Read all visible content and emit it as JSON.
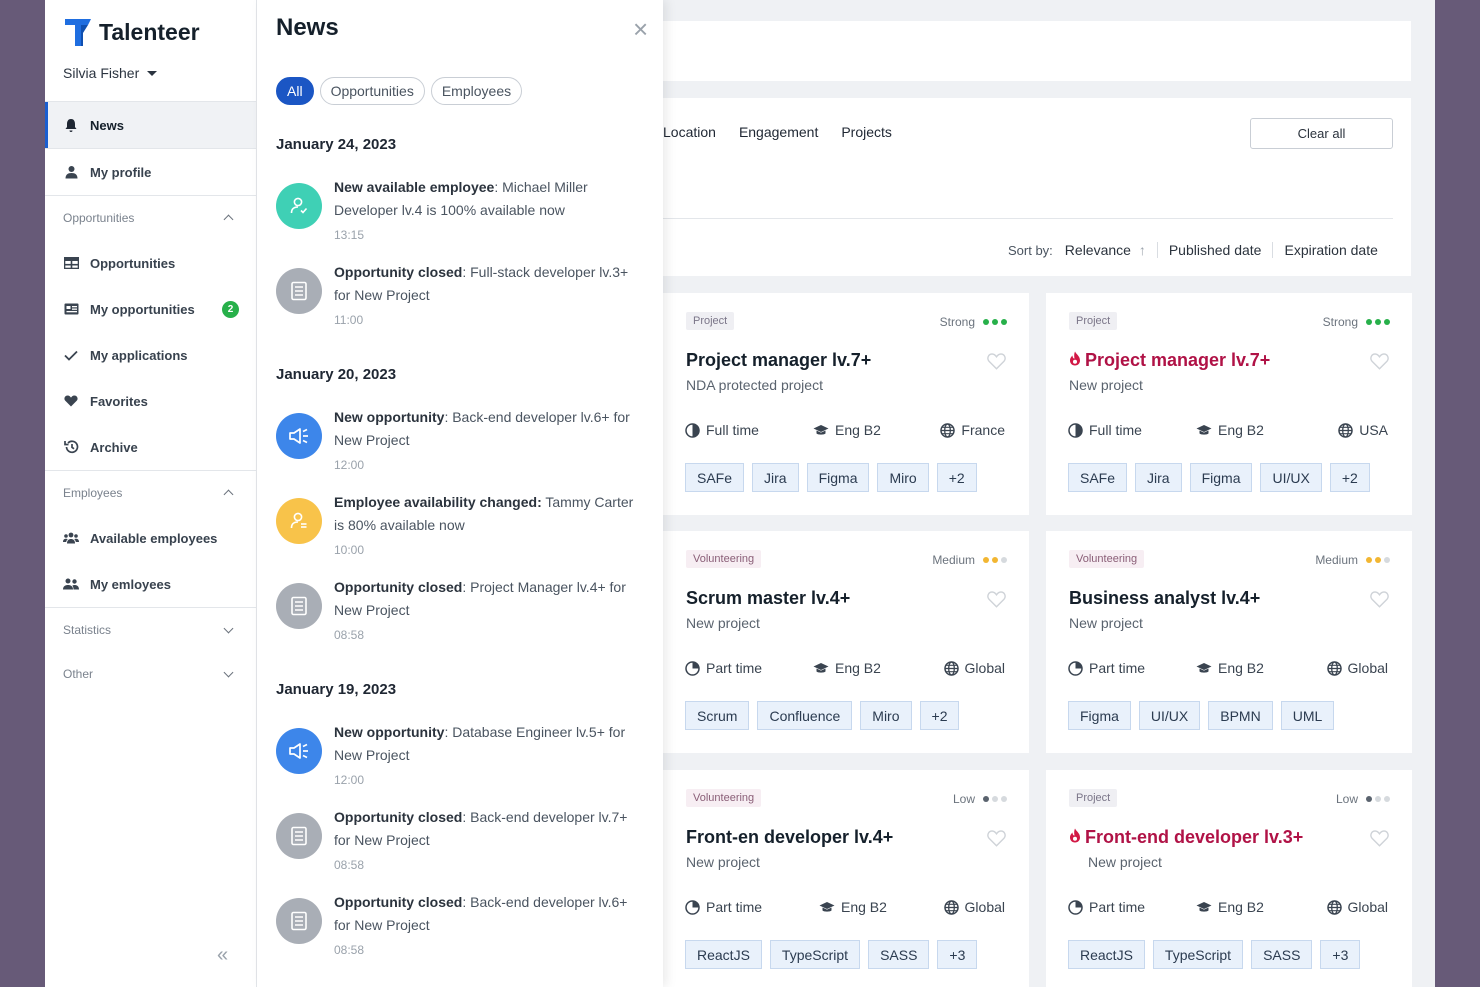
{
  "brand": {
    "name": "Talenteer"
  },
  "user": {
    "name": "Silvia Fisher"
  },
  "sidebar": {
    "items": [
      {
        "label": "News",
        "icon": "bell-icon"
      },
      {
        "label": "My profile",
        "icon": "user-icon"
      }
    ],
    "groups": [
      {
        "label": "Opportunities",
        "items": [
          {
            "label": "Opportunities",
            "icon": "grid-icon"
          },
          {
            "label": "My opportunities",
            "icon": "card-icon",
            "badge": "2"
          },
          {
            "label": "My applications",
            "icon": "check-icon"
          },
          {
            "label": "Favorites",
            "icon": "heart-icon"
          },
          {
            "label": "Archive",
            "icon": "history-icon"
          }
        ]
      },
      {
        "label": "Employees",
        "items": [
          {
            "label": "Available employees",
            "icon": "users-icon"
          },
          {
            "label": "My emloyees",
            "icon": "users-icon"
          }
        ]
      },
      {
        "label": "Statistics"
      },
      {
        "label": "Other"
      }
    ],
    "collapse_label": "«"
  },
  "news": {
    "title": "News",
    "filters": [
      "All",
      "Opportunities",
      "Employees"
    ],
    "groups": [
      {
        "date": "January 24, 2023",
        "items": [
          {
            "type": "employee",
            "bold": "New available employee",
            "text": ": Michael Miller Developer lv.4 is 100% available now",
            "time": "13:15"
          },
          {
            "type": "closed",
            "bold": "Opportunity closed",
            "text": ": Full-stack developer lv.3+ for New Project",
            "time": "11:00"
          }
        ]
      },
      {
        "date": "January 20, 2023",
        "items": [
          {
            "type": "opportunity",
            "bold": "New opportunity",
            "text": ": Back-end developer lv.6+ for New Project",
            "time": "12:00"
          },
          {
            "type": "availability",
            "bold": "Employee availability changed:",
            "text": " Tammy Carter is 80% available now",
            "time": "10:00"
          },
          {
            "type": "closed",
            "bold": "Opportunity closed",
            "text": ": Project Manager lv.4+ for New Project",
            "time": "08:58"
          }
        ]
      },
      {
        "date": "January 19, 2023",
        "items": [
          {
            "type": "opportunity",
            "bold": "New opportunity",
            "text": ": Database Engineer lv.5+ for New Project",
            "time": "12:00"
          },
          {
            "type": "closed",
            "bold": "Opportunity closed",
            "text": ": Back-end developer lv.7+ for New Project",
            "time": "08:58"
          },
          {
            "type": "closed",
            "bold": "Opportunity closed",
            "text": ": Back-end developer lv.6+ for New Project",
            "time": "08:58"
          }
        ]
      }
    ],
    "type_colors": {
      "employee": "#3fd0b5",
      "closed": "#a9aeb6",
      "opportunity": "#3d86ea",
      "availability": "#f8c34a"
    }
  },
  "filters_bar": {
    "tabs": [
      "Location",
      "Engagement",
      "Projects"
    ],
    "clear_label": "Clear all",
    "sort_label": "Sort by:",
    "sort_options": [
      "Relevance",
      "Published date",
      "Expiration date"
    ]
  },
  "jobs": [
    {
      "tag": "Project",
      "match": "Strong",
      "match_level": 3,
      "title": "Project manager lv.7+",
      "hot": false,
      "subtitle": "NDA protected project",
      "schedule": "Full time",
      "language": "Eng B2",
      "location": "France",
      "skills": [
        "SAFe",
        "Jira",
        "Figma",
        "Miro",
        "+2"
      ]
    },
    {
      "tag": "Project",
      "match": "Strong",
      "match_level": 3,
      "title": "Project manager lv.7+",
      "hot": true,
      "subtitle": "New project",
      "schedule": "Full time",
      "language": "Eng B2",
      "location": "USA",
      "skills": [
        "SAFe",
        "Jira",
        "Figma",
        "UI/UX",
        "+2"
      ]
    },
    {
      "tag": "Volunteering",
      "match": "Medium",
      "match_level": 2,
      "title": "Scrum master lv.4+",
      "hot": false,
      "subtitle": "New project",
      "schedule": "Part time",
      "language": "Eng B2",
      "location": "Global",
      "skills": [
        "Scrum",
        "Confluence",
        "Miro",
        "+2"
      ]
    },
    {
      "tag": "Volunteering",
      "match": "Medium",
      "match_level": 2,
      "title": "Business analyst lv.4+",
      "hot": false,
      "subtitle": "New project",
      "schedule": "Part time",
      "language": "Eng B2",
      "location": "Global",
      "skills": [
        "Figma",
        "UI/UX",
        "BPMN",
        "UML"
      ]
    },
    {
      "tag": "Volunteering",
      "match": "Low",
      "match_level": 1,
      "title": "Front-en developer lv.4+",
      "hot": false,
      "subtitle": "New project",
      "schedule": "Part time",
      "language": "Eng B2",
      "location": "Global",
      "skills": [
        "ReactJS",
        "TypeScript",
        "SASS",
        "+3"
      ]
    },
    {
      "tag": "Project",
      "match": "Low",
      "match_level": 1,
      "title": "Front-end developer lv.3+",
      "hot": true,
      "subtitle": "New project",
      "schedule": "Part time",
      "language": "Eng B2",
      "location": "Global",
      "skills": [
        "ReactJS",
        "TypeScript",
        "SASS",
        "+3"
      ]
    }
  ],
  "colors": {
    "accent": "#1b56c4",
    "badge": "#27b04a",
    "hot": "#b01246",
    "strong": "#27b04a",
    "medium": "#f2b632",
    "low": "#5a636e"
  }
}
